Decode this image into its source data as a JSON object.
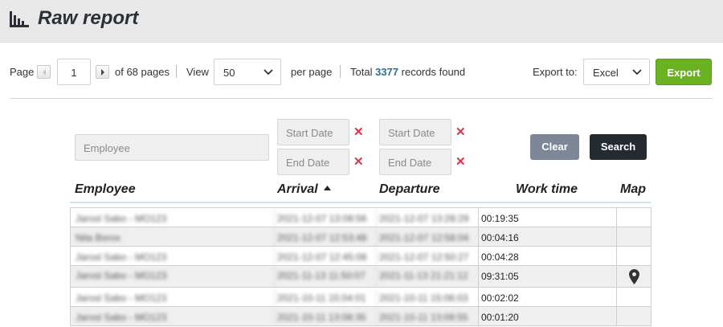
{
  "header": {
    "logo_icon": "bar-chart-icon",
    "title": "Raw report"
  },
  "pager": {
    "page_label": "Page",
    "current_page": "1",
    "of_pages": "of 68 pages",
    "view_label": "View",
    "per_page_value": "50",
    "per_page_label": "per page",
    "total_prefix": "Total",
    "total_count": "3377",
    "total_suffix": "records found",
    "export_label": "Export to:",
    "export_format": "Excel",
    "export_button": "Export"
  },
  "filters": {
    "employee_placeholder": "Employee",
    "start_date_1": "Start Date",
    "end_date_1": "End Date",
    "start_date_2": "Start Date",
    "end_date_2": "End Date",
    "clear_button": "Clear",
    "search_button": "Search"
  },
  "table": {
    "columns": {
      "employee": "Employee",
      "arrival": "Arrival",
      "departure": "Departure",
      "work_time": "Work time",
      "map": "Map"
    },
    "sort": {
      "column": "arrival",
      "direction": "ascending"
    },
    "rows": [
      {
        "employee": "Jarosl Sabo - MO123",
        "arrival": "2021-12-07 13:08:56",
        "departure": "2021-12-07 13:28:29",
        "work_time": "00:19:35",
        "map": false
      },
      {
        "employee": "Nita Borox",
        "arrival": "2021-12-07 12:53:48",
        "departure": "2021-12-07 12:58:04",
        "work_time": "00:04:16",
        "map": false
      },
      {
        "employee": "Jarosl Sabo - MO123",
        "arrival": "2021-12-07 12:45:08",
        "departure": "2021-12-07 12:50:27",
        "work_time": "00:04:28",
        "map": false
      },
      {
        "employee": "Jarosl Sabo - MO123",
        "arrival": "2021-11-13 11:50:07",
        "departure": "2021-11-13 21:21:12",
        "work_time": "09:31:05",
        "map": true
      },
      {
        "employee": "Jarosl Sabo - MO123",
        "arrival": "2021-10-11 15:04:01",
        "departure": "2021-10-11 15:06:03",
        "work_time": "00:02:02",
        "map": false
      },
      {
        "employee": "Jarosl Sabo - MO123",
        "arrival": "2021-10-11 13:08:35",
        "departure": "2021-10-11 13:09:55",
        "work_time": "00:01:20",
        "map": false
      }
    ]
  }
}
